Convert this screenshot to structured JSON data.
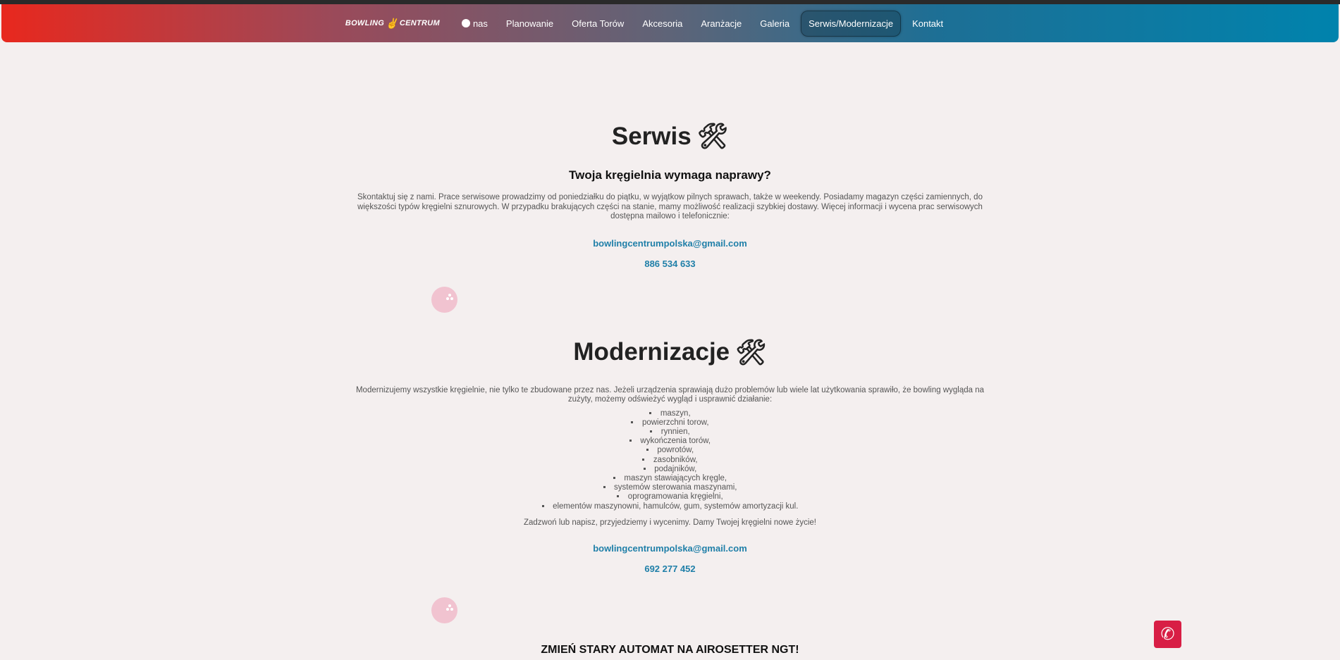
{
  "nav": {
    "logo_left": "BOWLING",
    "logo_right": "CENTRUM",
    "items": [
      "nas",
      "Planowanie",
      "Oferta Torów",
      "Akcesoria",
      "Aranżacje",
      "Galeria",
      "Serwis/Modernizacje",
      "Kontakt"
    ],
    "active": "Serwis/Modernizacje"
  },
  "serwis": {
    "title": "Serwis",
    "subtitle": "Twoja kręgielnia wymaga naprawy?",
    "text": "Skontaktuj się z nami. Prace serwisowe prowadzimy od poniedziałku do piątku, w wyjątkow pilnych sprawach, także w weekendy. Posiadamy magazyn części zamiennych, do większości typów kręgielni sznurowych. W przypadku brakujących części na stanie, mamy możliwość realizacji szybkiej dostawy. Więcej informacji i wycena prac serwisowych dostępna mailowo i telefonicznie:",
    "email": "bowlingcentrumpolska@gmail.com",
    "phone": "886 534 633"
  },
  "modernizacje": {
    "title": "Modernizacje",
    "text": "Modernizujemy wszystkie kręgielnie, nie tylko te zbudowane przez nas. Jeżeli urządzenia sprawiają dużo problemów lub wiele lat użytkowania sprawiło, że bowling wygląda na zużyty, możemy odświeżyć wygląd i usprawnić działanie:",
    "items": [
      "maszyn,",
      "powierzchni torow,",
      "rynnien,",
      "wykończenia torów,",
      "powrotów,",
      "zasobników,",
      "podajników,",
      "maszyn stawiających kręgle,",
      "systemów sterowania maszynami,",
      "oprogramowania kręgielni,",
      "elementów maszynowni, hamulców, gum, systemów amortyzacji kul."
    ],
    "closing": "Zadzwoń lub napisz, przyjedziemy i wycenimy. Damy Twojej kręgielni nowe życie!",
    "email": "bowlingcentrumpolska@gmail.com",
    "phone": "692 277 452"
  },
  "promo": "ZMIEŃ STARY AUTOMAT NA AIROSETTER NGT!",
  "colors": {
    "accent": "#1f7fa8",
    "call": "#d81e45"
  }
}
